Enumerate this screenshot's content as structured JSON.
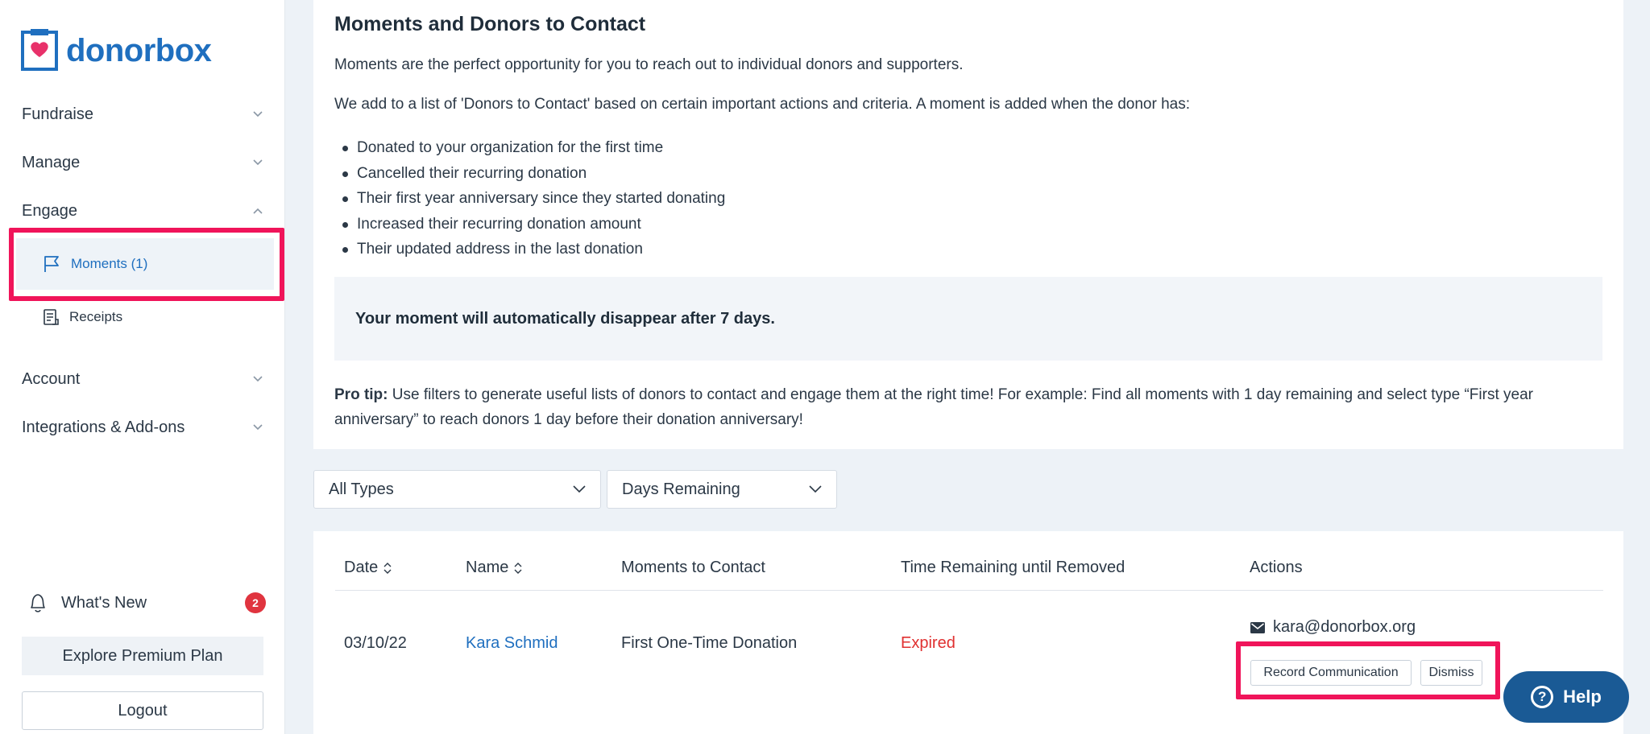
{
  "brand": {
    "name": "donorbox",
    "color": "#1f6fbf",
    "accent": "#e8316a"
  },
  "sidebar": {
    "nav": [
      {
        "label": "Fundraise",
        "icon": "chevron-down-icon"
      },
      {
        "label": "Manage",
        "icon": "chevron-down-icon"
      },
      {
        "label": "Engage",
        "icon": "chevron-up-icon"
      },
      {
        "label": "Account",
        "icon": "chevron-down-icon"
      },
      {
        "label": "Integrations & Add-ons",
        "icon": "chevron-down-icon"
      }
    ],
    "engage_sub": [
      {
        "label": "Moments (1)",
        "icon": "flag-icon",
        "active": true
      },
      {
        "label": "Receipts",
        "icon": "receipt-icon"
      }
    ],
    "whats_new": {
      "label": "What's New",
      "count": "2"
    },
    "premium_label": "Explore Premium Plan",
    "logout_label": "Logout"
  },
  "info": {
    "title": "Moments and Donors to Contact",
    "intro": "Moments are the perfect opportunity for you to reach out to individual donors and supporters.",
    "criteria_intro": "We add to a list of 'Donors to Contact' based on certain important actions and criteria. A moment is added when the donor has:",
    "criteria": [
      "Donated to your organization for the first time",
      "Cancelled their recurring donation",
      "Their first year anniversary since they started donating",
      "Increased their recurring donation amount",
      "Their updated address in the last donation"
    ],
    "notice": "Your moment will automatically disappear after 7 days.",
    "protip_label": "Pro tip:",
    "protip_text": " Use filters to generate useful lists of donors to contact and engage them at the right time! For example: Find all moments with 1 day remaining and select type “First year anniversary” to reach donors 1 day before their donation anniversary!"
  },
  "filters": {
    "type": "All Types",
    "days": "Days Remaining"
  },
  "table": {
    "headers": [
      "Date",
      "Name",
      "Moments to Contact",
      "Time Remaining until Removed",
      "Actions"
    ],
    "rows": [
      {
        "date": "03/10/22",
        "name": "Kara Schmid",
        "moment": "First One-Time Donation",
        "remaining": "Expired",
        "email": "kara@donorbox.org",
        "record_label": "Record Communication",
        "dismiss_label": "Dismiss"
      }
    ]
  },
  "help_label": "Help",
  "colors": {
    "highlight": "#f0145a",
    "expired": "#e03030",
    "help_bg": "#1a5a95"
  }
}
